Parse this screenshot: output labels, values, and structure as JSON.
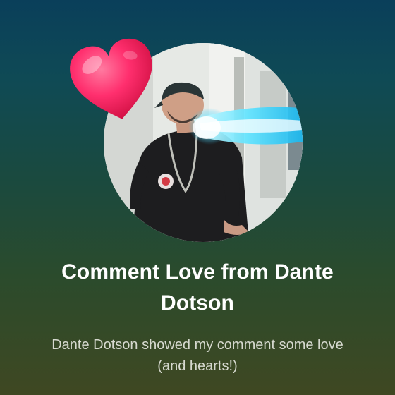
{
  "card": {
    "title": "Comment Love from Dante Dotson",
    "description": "Dante Dotson showed my comment some love (and hearts!)"
  },
  "icons": {
    "heart": "heart-icon",
    "avatar": "profile-photo"
  },
  "colors": {
    "background_top": "#0a3f5a",
    "background_bottom": "#3f4822",
    "heart": "#ff2f6e",
    "title_text": "#ffffff",
    "description_text": "#d6d9cf"
  }
}
